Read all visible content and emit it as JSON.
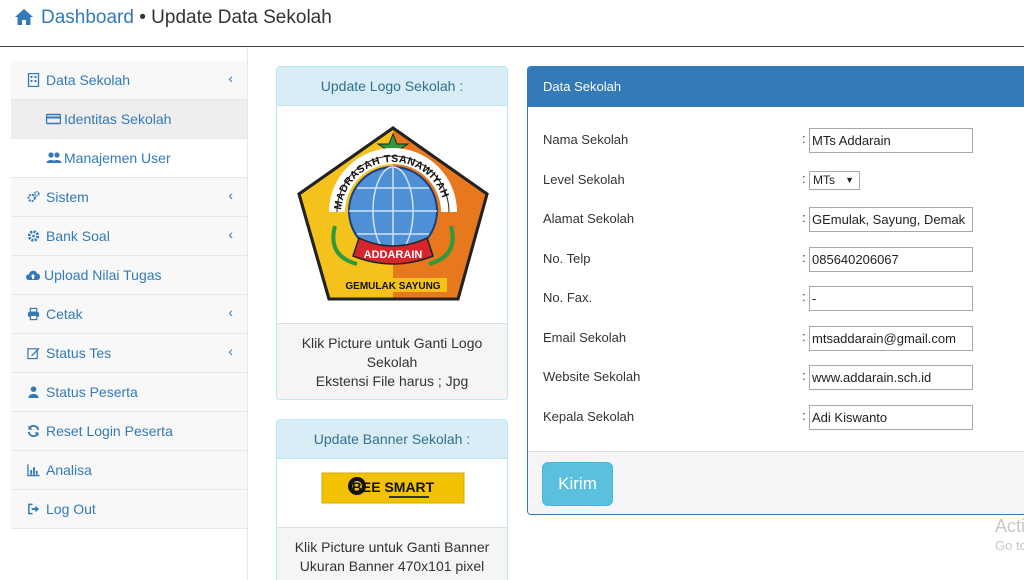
{
  "header": {
    "breadcrumb_home": "Dashboard",
    "separator": " • ",
    "page_title": "Update Data Sekolah"
  },
  "sidebar": {
    "items": [
      {
        "label": "Data Sekolah",
        "icon": "building-icon",
        "has_submenu": true
      },
      {
        "label": "Identitas Sekolah",
        "icon": "id-card-icon",
        "sub": true,
        "active": true
      },
      {
        "label": "Manajemen User",
        "icon": "users-icon",
        "sub": true
      },
      {
        "label": "Sistem",
        "icon": "cogs-icon",
        "has_submenu": true
      },
      {
        "label": "Bank Soal",
        "icon": "gear-icon",
        "has_submenu": true
      },
      {
        "label": "Upload Nilai Tugas",
        "icon": "cloud-upload-icon"
      },
      {
        "label": "Cetak",
        "icon": "print-icon",
        "has_submenu": true
      },
      {
        "label": "Status Tes",
        "icon": "edit-icon",
        "has_submenu": true
      },
      {
        "label": "Status Peserta",
        "icon": "user-icon"
      },
      {
        "label": "Reset Login Peserta",
        "icon": "refresh-icon"
      },
      {
        "label": "Analisa",
        "icon": "bar-chart-icon"
      },
      {
        "label": "Log Out",
        "icon": "sign-out-icon"
      }
    ],
    "chevron": "‹"
  },
  "logo_panel": {
    "heading": "Update Logo Sekolah :",
    "footer_line1": "Klik Picture untuk Ganti Logo",
    "footer_line2": "Sekolah",
    "footer_line3": "Ekstensi File harus ; Jpg",
    "logo_text_top": "MADRASAH TSANAWIYAH",
    "logo_text_ribbon": "ADDARAIN",
    "logo_text_bottom": "GEMULAK SAYUNG"
  },
  "banner_panel": {
    "heading": "Update Banner Sekolah :",
    "footer_line1": "Klik Picture untuk Ganti Banner",
    "footer_line2": "Ukuran Banner 470x101 pixel",
    "banner_text": "BEE SMART"
  },
  "data_panel": {
    "heading": "Data Sekolah",
    "fields": [
      {
        "label": "Nama Sekolah",
        "value": "MTs Addarain",
        "type": "text"
      },
      {
        "label": "Level Sekolah",
        "value": "MTs",
        "type": "select"
      },
      {
        "label": "Alamat Sekolah",
        "value": "GEmulak, Sayung, Demak",
        "type": "text"
      },
      {
        "label": "No. Telp",
        "value": "085640206067",
        "type": "text"
      },
      {
        "label": "No. Fax.",
        "value": "-",
        "type": "text"
      },
      {
        "label": "Email Sekolah",
        "value": "mtsaddarain@gmail.com",
        "type": "text"
      },
      {
        "label": "Website Sekolah",
        "value": "www.addarain.sch.id",
        "type": "text"
      },
      {
        "label": "Kepala Sekolah",
        "value": "Adi Kiswanto",
        "type": "text"
      }
    ],
    "colon": ":",
    "submit_label": "Kirim"
  },
  "watermark": {
    "line1": "Acti",
    "line2": "Go to"
  },
  "colors": {
    "primary": "#337ab7",
    "info_bg": "#d9edf7",
    "btn_info": "#5bc0de"
  }
}
